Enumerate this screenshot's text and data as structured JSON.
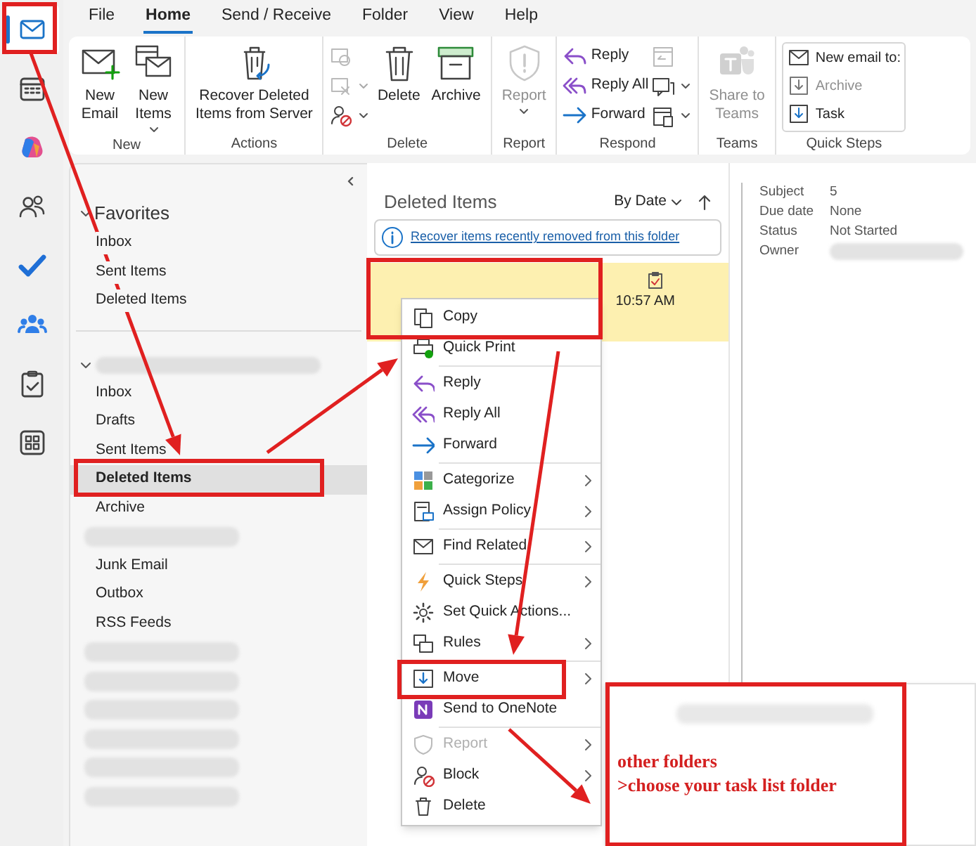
{
  "nav_rail": [
    {
      "kind": "mail",
      "selected": true
    },
    {
      "kind": "calendar",
      "selected": false
    },
    {
      "kind": "copilot",
      "selected": false
    },
    {
      "kind": "people",
      "selected": false
    },
    {
      "kind": "todo",
      "selected": false
    },
    {
      "kind": "groups",
      "selected": false
    },
    {
      "kind": "tasks",
      "selected": false
    },
    {
      "kind": "apps",
      "selected": false
    }
  ],
  "ribbon_tabs": [
    {
      "label": "File",
      "selected": false
    },
    {
      "label": "Home",
      "selected": true
    },
    {
      "label": "Send / Receive",
      "selected": false
    },
    {
      "label": "Folder",
      "selected": false
    },
    {
      "label": "View",
      "selected": false
    },
    {
      "label": "Help",
      "selected": false
    }
  ],
  "ribbon_groups": [
    {
      "label": "New",
      "buttons": [
        {
          "kind": "new-email",
          "label": "New\nEmail",
          "disabled": false,
          "has_menu": false
        },
        {
          "kind": "new-items",
          "label": "New\nItems",
          "disabled": false,
          "has_menu": true
        }
      ]
    },
    {
      "label": "Actions",
      "buttons": [
        {
          "kind": "recover",
          "label": "Recover Deleted\nItems from Server",
          "disabled": false,
          "has_menu": false
        }
      ]
    },
    {
      "label": "Delete",
      "buttons": [
        {
          "kind": "ignore",
          "disabled": true,
          "has_menu": false
        },
        {
          "kind": "cleanup",
          "disabled": true,
          "has_menu": true
        },
        {
          "kind": "block",
          "disabled": false,
          "has_menu": true
        },
        {
          "kind": "delete",
          "label": "Delete",
          "disabled": false,
          "has_menu": false
        },
        {
          "kind": "archive",
          "label": "Archive",
          "disabled": false,
          "has_menu": false
        }
      ]
    },
    {
      "label": "Report",
      "buttons": [
        {
          "kind": "report",
          "label": "Report",
          "disabled": true,
          "has_menu": true
        }
      ]
    },
    {
      "label": "Respond",
      "buttons": [
        {
          "kind": "reply",
          "label": "Reply",
          "disabled": false,
          "has_menu": false
        },
        {
          "kind": "reply-all",
          "label": "Reply All",
          "disabled": false,
          "has_menu": false
        },
        {
          "kind": "forward",
          "label": "Forward",
          "disabled": false,
          "has_menu": false
        },
        {
          "kind": "meeting",
          "disabled": true,
          "has_menu": false
        },
        {
          "kind": "chat",
          "disabled": false,
          "has_menu": true
        },
        {
          "kind": "more",
          "disabled": false,
          "has_menu": true
        }
      ]
    },
    {
      "label": "Teams",
      "buttons": [
        {
          "kind": "teams",
          "label": "Share to\nTeams",
          "disabled": true,
          "has_menu": false
        }
      ]
    },
    {
      "label": "Quick Steps",
      "gallery": true,
      "buttons": [
        {
          "kind": "new-email-to",
          "label": "New email to:",
          "disabled": false,
          "has_menu": false
        },
        {
          "kind": "archive-step",
          "label": "Archive",
          "disabled": true,
          "has_menu": false
        },
        {
          "kind": "task",
          "label": "Task",
          "disabled": false,
          "has_menu": false
        }
      ]
    }
  ],
  "folder_pane": {
    "favorites": {
      "label": "Favorites",
      "expanded": true,
      "items": [
        {
          "label": "Inbox",
          "selected": false
        },
        {
          "label": "Sent Items",
          "selected": false
        },
        {
          "label": "Deleted Items",
          "selected": false
        }
      ]
    },
    "account": {
      "expanded": true,
      "items": [
        {
          "label": "Inbox",
          "selected": false,
          "blurred": false
        },
        {
          "label": "Drafts",
          "selected": false,
          "blurred": false
        },
        {
          "label": "Sent Items",
          "selected": false,
          "blurred": false
        },
        {
          "label": "Deleted Items",
          "selected": true,
          "blurred": false
        },
        {
          "label": "Archive",
          "selected": false,
          "blurred": false
        },
        {
          "blurred": true
        },
        {
          "label": "Junk Email",
          "selected": false,
          "blurred": false
        },
        {
          "label": "Outbox",
          "selected": false,
          "blurred": false
        },
        {
          "label": "RSS Feeds",
          "selected": false,
          "blurred": false
        },
        {
          "blurred": true
        },
        {
          "blurred": true
        },
        {
          "blurred": true
        },
        {
          "blurred": true
        },
        {
          "blurred": true
        },
        {
          "blurred": true
        }
      ]
    }
  },
  "message_list": {
    "title": "Deleted Items",
    "sort": "By Date",
    "banner_link": "Recover items recently removed from this folder",
    "messages": [
      {
        "time": "10:57 AM",
        "selected": true
      }
    ]
  },
  "reading_pane": {
    "fields": [
      {
        "label": "Subject",
        "value": "5"
      },
      {
        "label": "Due date",
        "value": "None"
      },
      {
        "label": "Status",
        "value": "Not Started"
      },
      {
        "label": "Owner",
        "blurred": true
      }
    ]
  },
  "context_menu": {
    "sections": [
      [
        {
          "kind": "copy",
          "label": "Copy",
          "submenu": false,
          "disabled": false
        },
        {
          "kind": "print",
          "label": "Quick Print",
          "submenu": false,
          "disabled": false
        }
      ],
      [
        {
          "kind": "reply",
          "label": "Reply",
          "submenu": false,
          "disabled": false
        },
        {
          "kind": "reply-all",
          "label": "Reply All",
          "submenu": false,
          "disabled": false
        },
        {
          "kind": "forward",
          "label": "Forward",
          "submenu": false,
          "disabled": false
        }
      ],
      [
        {
          "kind": "categorize",
          "label": "Categorize",
          "submenu": true,
          "disabled": false
        },
        {
          "kind": "policy",
          "label": "Assign Policy",
          "submenu": true,
          "disabled": false
        }
      ],
      [
        {
          "kind": "find",
          "label": "Find Related",
          "submenu": true,
          "disabled": false
        }
      ],
      [
        {
          "kind": "quick-steps",
          "label": "Quick Steps",
          "submenu": true,
          "disabled": false
        },
        {
          "kind": "quick-actions",
          "label": "Set Quick Actions...",
          "submenu": false,
          "disabled": false
        },
        {
          "kind": "rules",
          "label": "Rules",
          "submenu": true,
          "disabled": false
        }
      ],
      [
        {
          "kind": "move",
          "label": "Move",
          "submenu": true,
          "disabled": false
        },
        {
          "kind": "onenote",
          "label": "Send to OneNote",
          "submenu": false,
          "disabled": false
        }
      ],
      [
        {
          "kind": "report",
          "label": "Report",
          "submenu": true,
          "disabled": true
        },
        {
          "kind": "block",
          "label": "Block",
          "submenu": true,
          "disabled": false
        },
        {
          "kind": "delete",
          "label": "Delete",
          "submenu": false,
          "disabled": false
        }
      ]
    ]
  },
  "annotation": {
    "lines": [
      "other folders",
      ">choose your task list folder"
    ]
  }
}
